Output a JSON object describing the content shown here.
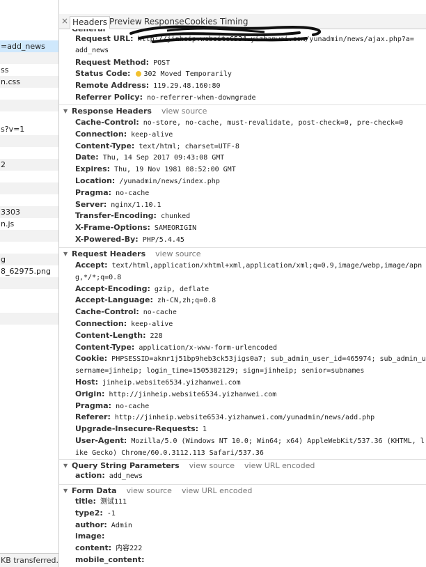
{
  "left_list": [
    {
      "text": "=add_news",
      "selected": true
    },
    {
      "text": ""
    },
    {
      "text": "ss"
    },
    {
      "text": "n.css"
    },
    {
      "text": ""
    },
    {
      "text": ""
    },
    {
      "text": "s?v=1"
    },
    {
      "text": ""
    },
    {
      "text": ""
    },
    {
      "text": "2"
    },
    {
      "text": ""
    },
    {
      "text": ""
    },
    {
      "text": ""
    },
    {
      "text": "3303"
    },
    {
      "text": "n.js"
    },
    {
      "text": ""
    },
    {
      "text": ""
    },
    {
      "text": "g"
    },
    {
      "text": "8_62975.png"
    },
    {
      "text": ""
    },
    {
      "text": ""
    },
    {
      "text": ""
    }
  ],
  "left_status": "KB transferred...",
  "tabs": [
    "Headers",
    "Preview",
    "Response",
    "Cookies",
    "Timing"
  ],
  "active_tab": "Headers",
  "status_dot_color": "#f2c12e",
  "general": {
    "title": "General",
    "rows": [
      {
        "k": "Request URL:",
        "v": "http://jinheip.website6534.yizhanwei.com/yunadmin/news/ajax.php?a="
      },
      {
        "k": "",
        "v": "add_news"
      },
      {
        "k": "Request Method:",
        "v": "POST"
      },
      {
        "k": "Status Code:",
        "v": "302 Moved Temporarily"
      },
      {
        "k": "Remote Address:",
        "v": "119.29.48.160:80"
      },
      {
        "k": "Referrer Policy:",
        "v": "no-referrer-when-downgrade"
      }
    ]
  },
  "response_headers": {
    "title": "Response Headers",
    "link1": "view source",
    "rows": [
      {
        "k": "Cache-Control:",
        "v": "no-store, no-cache, must-revalidate, post-check=0, pre-check=0"
      },
      {
        "k": "Connection:",
        "v": "keep-alive"
      },
      {
        "k": "Content-Type:",
        "v": "text/html; charset=UTF-8"
      },
      {
        "k": "Date:",
        "v": "Thu, 14 Sep 2017 09:43:08 GMT"
      },
      {
        "k": "Expires:",
        "v": "Thu, 19 Nov 1981 08:52:00 GMT"
      },
      {
        "k": "Location:",
        "v": "/yunadmin/news/index.php"
      },
      {
        "k": "Pragma:",
        "v": "no-cache"
      },
      {
        "k": "Server:",
        "v": "nginx/1.10.1"
      },
      {
        "k": "Transfer-Encoding:",
        "v": "chunked"
      },
      {
        "k": "X-Frame-Options:",
        "v": "SAMEORIGIN"
      },
      {
        "k": "X-Powered-By:",
        "v": "PHP/5.4.45"
      }
    ]
  },
  "request_headers": {
    "title": "Request Headers",
    "link1": "view source",
    "rows": [
      {
        "k": "Accept:",
        "v": "text/html,application/xhtml+xml,application/xml;q=0.9,image/webp,image/apng,*/*;q=0.8"
      },
      {
        "k": "Accept-Encoding:",
        "v": "gzip, deflate"
      },
      {
        "k": "Accept-Language:",
        "v": "zh-CN,zh;q=0.8"
      },
      {
        "k": "Cache-Control:",
        "v": "no-cache"
      },
      {
        "k": "Connection:",
        "v": "keep-alive"
      },
      {
        "k": "Content-Length:",
        "v": "228"
      },
      {
        "k": "Content-Type:",
        "v": "application/x-www-form-urlencoded"
      },
      {
        "k": "Cookie:",
        "v": "PHPSESSID=akmr1j51bp9heb3ck53jigs0a7; sub_admin_user_id=465974; sub_admin_username=jinheip; login_time=1505382129; sign=jinheip; senior=subnames"
      },
      {
        "k": "Host:",
        "v": "jinheip.website6534.yizhanwei.com"
      },
      {
        "k": "Origin:",
        "v": "http://jinheip.website6534.yizhanwei.com"
      },
      {
        "k": "Pragma:",
        "v": "no-cache"
      },
      {
        "k": "Referer:",
        "v": "http://jinheip.website6534.yizhanwei.com/yunadmin/news/add.php"
      },
      {
        "k": "Upgrade-Insecure-Requests:",
        "v": "1"
      },
      {
        "k": "User-Agent:",
        "v": "Mozilla/5.0 (Windows NT 10.0; Win64; x64) AppleWebKit/537.36 (KHTML, like Gecko) Chrome/60.0.3112.113 Safari/537.36"
      }
    ]
  },
  "query_string": {
    "title": "Query String Parameters",
    "link1": "view source",
    "link2": "view URL encoded",
    "rows": [
      {
        "k": "action:",
        "v": "add_news"
      }
    ]
  },
  "form_data": {
    "title": "Form Data",
    "link1": "view source",
    "link2": "view URL encoded",
    "rows": [
      {
        "k": "title:",
        "v": "测试111"
      },
      {
        "k": "type2:",
        "v": "-1"
      },
      {
        "k": "author:",
        "v": "Admin"
      },
      {
        "k": "image:",
        "v": ""
      },
      {
        "k": "content:",
        "v": "内容222"
      },
      {
        "k": "mobile_content:",
        "v": ""
      }
    ]
  }
}
